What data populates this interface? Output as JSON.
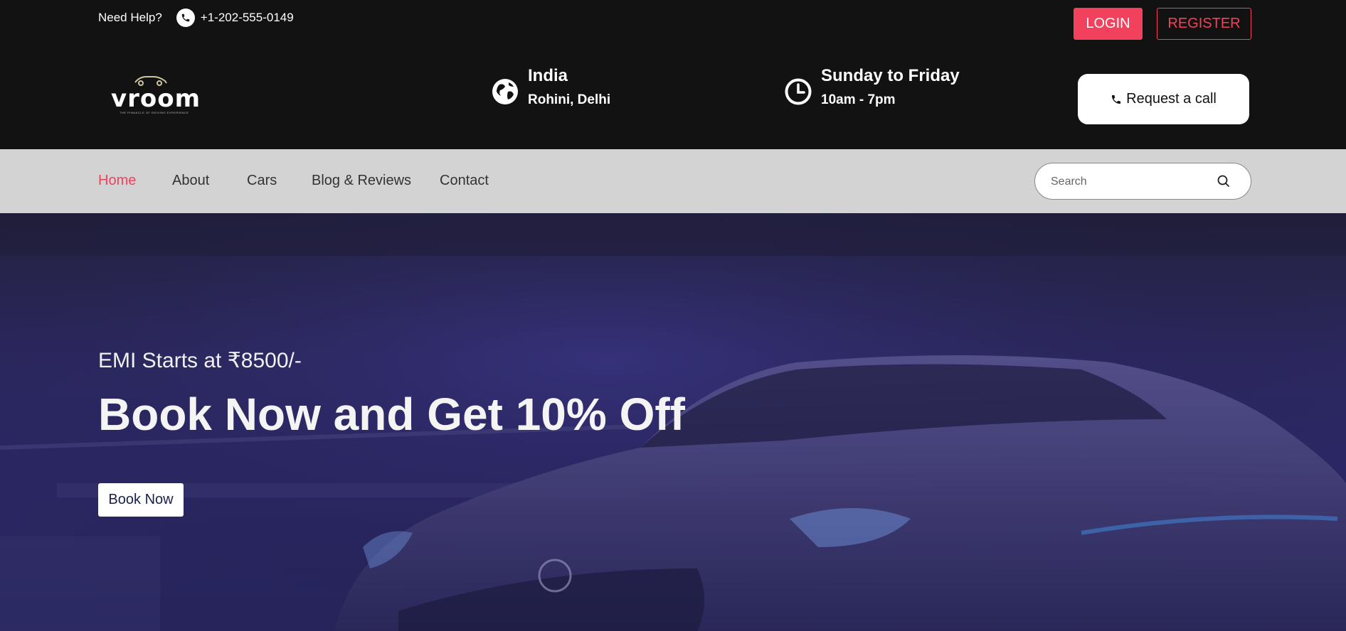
{
  "topbar": {
    "need_help": "Need Help?",
    "phone": "+1-202-555-0149",
    "login_label": "LOGIN",
    "register_label": "REGISTER"
  },
  "brand": {
    "logo_text": "vroom",
    "tagline": "THE PINNACLE OF DRIVING EXPERIENCE"
  },
  "location": {
    "country": "India",
    "city": "Rohini, Delhi",
    "icon": "globe-icon"
  },
  "hours": {
    "days": "Sunday to Friday",
    "time": "10am - 7pm",
    "icon": "clock-icon"
  },
  "request_call_label": "Request a call",
  "nav": {
    "items": [
      {
        "label": "Home",
        "active": true
      },
      {
        "label": "About",
        "active": false
      },
      {
        "label": "Cars",
        "active": false
      },
      {
        "label": "Blog & Reviews",
        "active": false
      },
      {
        "label": "Contact",
        "active": false
      }
    ],
    "search_placeholder": "Search"
  },
  "hero": {
    "emi": "EMI Starts at ₹8500/-",
    "title": "Book Now and Get 10% Off",
    "book_now_label": "Book Now"
  },
  "colors": {
    "accent": "#f2415d",
    "topbar_bg": "#121212",
    "navbar_bg": "#d3d3d3",
    "hero_bg": "#2c2860"
  }
}
